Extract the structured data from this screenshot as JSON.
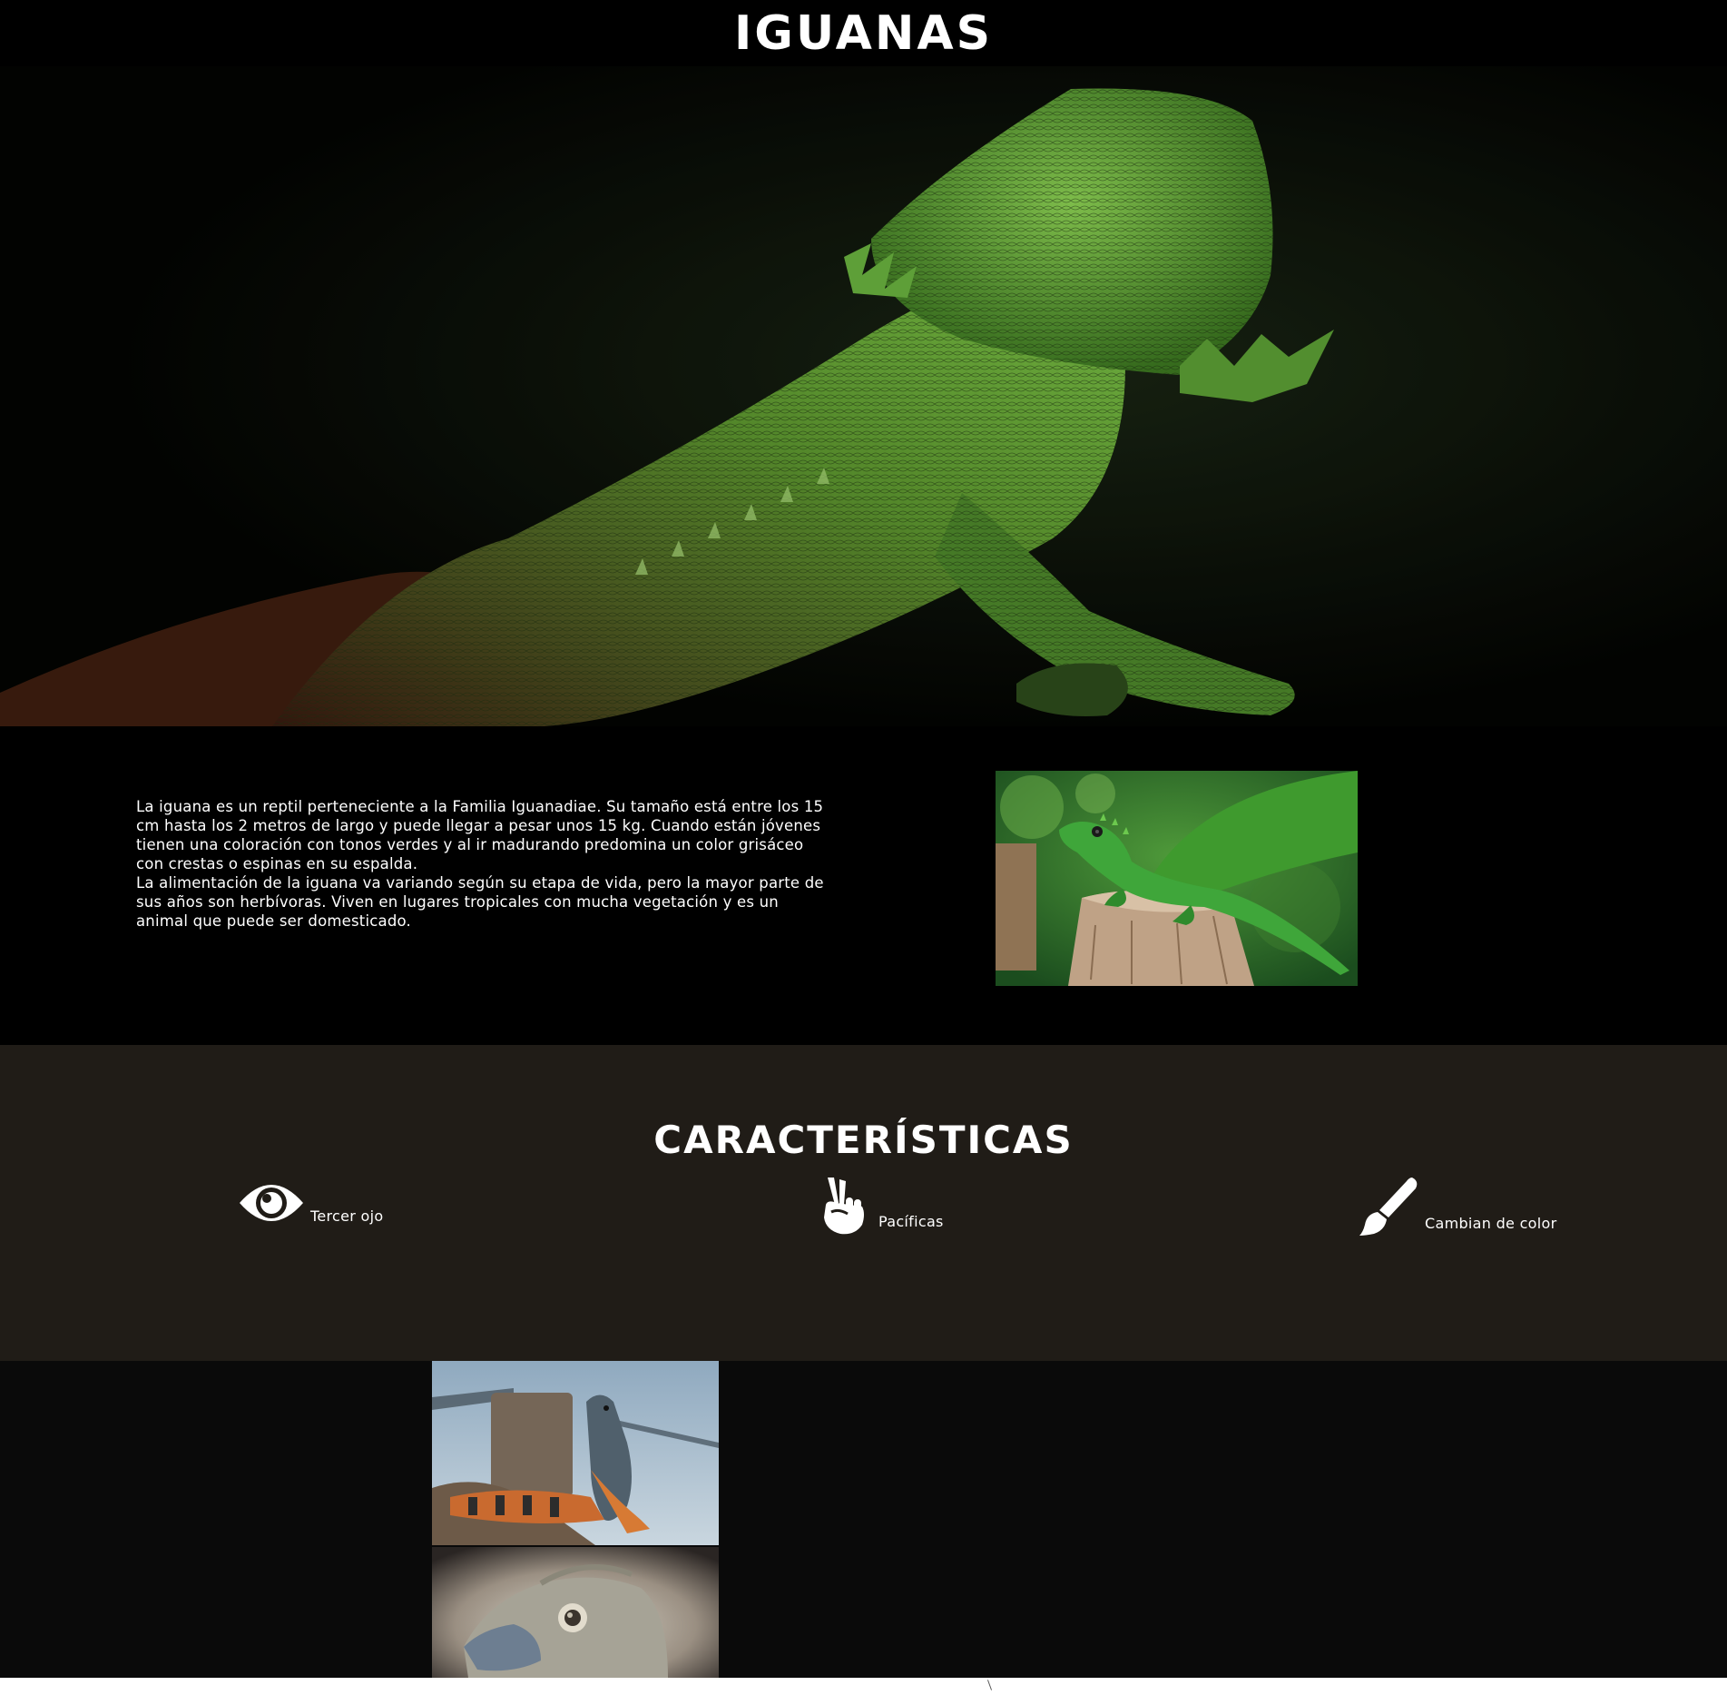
{
  "header": {
    "title": "IGUANAS"
  },
  "intro": {
    "paragraphs": [
      "La iguana es un reptil perteneciente a la Familia Iguanadiae. Su tamaño está entre los 15 cm hasta los 2 metros de largo y puede llegar a pesar unos 15 kg. Cuando están jóvenes tienen una coloración con tonos verdes y al ir madurando predomina un color grisáceo con crestas o espinas en su espalda.",
      "La alimentación de la iguana va variando según su etapa de vida, pero la mayor parte de sus años son herbívoras. Viven en lugares tropicales con mucha vegetación y es un animal que puede ser domesticado."
    ]
  },
  "features": {
    "title": "CARACTERÍSTICAS",
    "items": [
      {
        "icon": "eye-icon",
        "label": "Tercer ojo"
      },
      {
        "icon": "peace-hand-icon",
        "label": "Pacíficas"
      },
      {
        "icon": "paint-brush-icon",
        "label": "Cambian de color"
      }
    ]
  },
  "colors": {
    "header_bg": "#000000",
    "features_bg": "#201c17",
    "gallery_bg": "#0a0a0a",
    "text": "#ffffff",
    "iguana_green": "#6fb83a"
  }
}
